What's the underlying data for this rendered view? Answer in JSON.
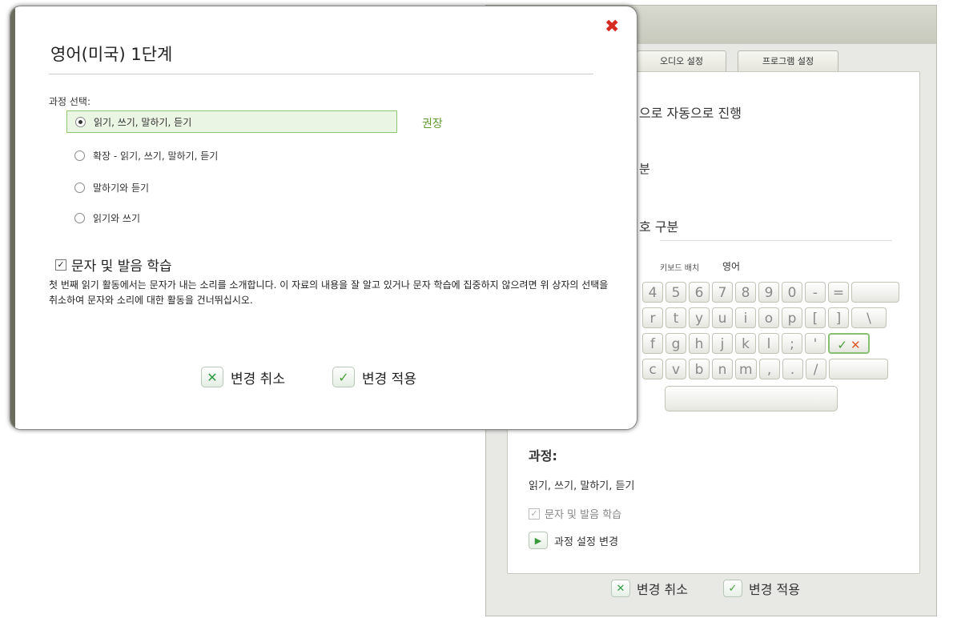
{
  "colors": {
    "accent_green": "#5e9a32",
    "close_red": "#d62b22",
    "selected_bg": "#eaf5e4"
  },
  "background_window": {
    "tabs": [
      "오디오 설정",
      "프로그램 설정"
    ],
    "lines": {
      "auto_progress": "으로 자동으로 진행",
      "partial1": "분",
      "symbol_sep": "호 구분",
      "keyboard_layout_label": "키보드 배치",
      "keyboard_layout_value": "영어"
    },
    "keyboard": {
      "row1": [
        "4",
        "5",
        "6",
        "7",
        "8",
        "9",
        "0",
        "-",
        "="
      ],
      "row2": [
        "r",
        "t",
        "y",
        "u",
        "i",
        "o",
        "p",
        "[",
        "]",
        "\\"
      ],
      "row3": [
        "f",
        "g",
        "h",
        "j",
        "k",
        "l",
        ";",
        "'"
      ],
      "row4": [
        "c",
        "v",
        "b",
        "n",
        "m",
        ",",
        ".",
        "/"
      ],
      "check": "✓",
      "cross": "✕"
    },
    "course_label": "과정:",
    "course_value": "읽기, 쓰기, 말하기, 듣기",
    "letters_checkbox": "문자 및 발음 학습",
    "change_settings": "과정 설정 변경",
    "cancel": "변경 취소",
    "apply": "변경 적용"
  },
  "modal": {
    "title": "영어(미국) 1단계",
    "close_glyph": "✖",
    "course_select_label": "과정 선택:",
    "options": [
      {
        "label": "읽기, 쓰기, 말하기, 듣기",
        "selected": true
      },
      {
        "label": "확장 - 읽기, 쓰기, 말하기, 듣기",
        "selected": false
      },
      {
        "label": "말하기와 듣기",
        "selected": false
      },
      {
        "label": "읽기와 쓰기",
        "selected": false
      }
    ],
    "recommended": "권장",
    "letters_checkbox": "문자 및 발음 학습",
    "description": "첫 번째 읽기 활동에서는 문자가 내는 소리를 소개합니다. 이 자료의 내용을 잘 알고 있거나 문자 학습에 집중하지 않으려면 위 상자의 선택을 취소하여 문자와 소리에 대한 활동을 건너뛰십시오.",
    "cancel": "변경 취소",
    "apply": "변경 적용"
  }
}
